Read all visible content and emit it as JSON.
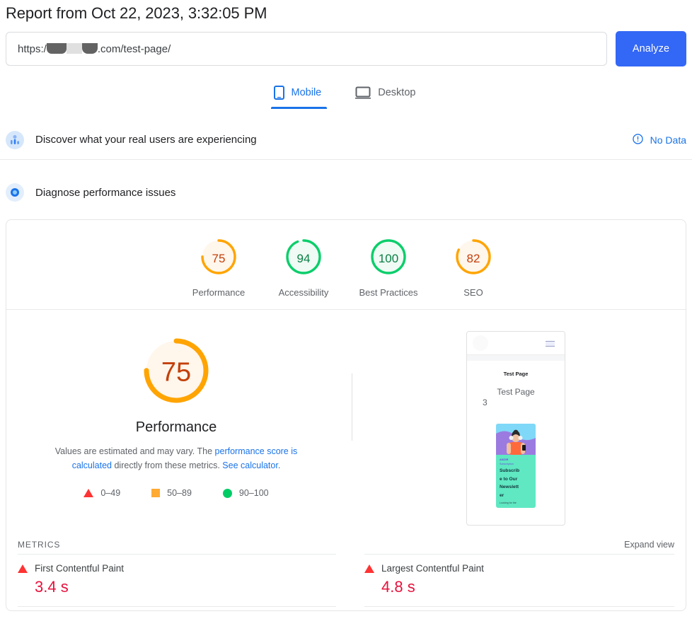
{
  "header": {
    "title": "Report from Oct 22, 2023, 3:32:05 PM",
    "url_prefix": "https:/",
    "url_suffix": ".com/test-page/",
    "url_full_visible": "https://[redacted].com/test-page/",
    "analyze_label": "Analyze"
  },
  "tabs": [
    {
      "label": "Mobile",
      "icon": "mobile-icon",
      "active": true
    },
    {
      "label": "Desktop",
      "icon": "desktop-icon",
      "active": false
    }
  ],
  "field_data": {
    "label": "Discover what your real users are experiencing",
    "icon": "crux-users-icon",
    "status": "No Data",
    "status_icon": "info-circle-icon"
  },
  "lab_data": {
    "label": "Diagnose performance issues",
    "icon": "lighthouse-icon"
  },
  "category_scores": [
    {
      "label": "Performance",
      "value": "75",
      "color": "#ffa400",
      "text_color": "#c3400a",
      "fill": "#fff6ec",
      "pct": 75
    },
    {
      "label": "Accessibility",
      "value": "94",
      "color": "#0cce6b",
      "text_color": "#0b7f45",
      "fill": "#effbf4",
      "pct": 94
    },
    {
      "label": "Best Practices",
      "value": "100",
      "color": "#0cce6b",
      "text_color": "#0b7f45",
      "fill": "#effbf4",
      "pct": 100
    },
    {
      "label": "SEO",
      "value": "82",
      "color": "#ffa400",
      "text_color": "#c3400a",
      "fill": "#fff6ec",
      "pct": 82
    }
  ],
  "performance": {
    "score": "75",
    "title": "Performance",
    "ring_color": "#ffa400",
    "fill_color": "#fff6ec",
    "score_color": "#c3400a",
    "disclaimer_pre": "Values are estimated and may vary. The ",
    "disclaimer_link1": "performance score is calculated",
    "disclaimer_mid": " directly from these metrics. ",
    "disclaimer_link2": "See calculator.",
    "legend": [
      {
        "shape": "triangle",
        "color": "#ff3333",
        "range": "0–49"
      },
      {
        "shape": "square",
        "color": "#ffaa33",
        "range": "50–89"
      },
      {
        "shape": "circle",
        "color": "#00cc66",
        "range": "90–100"
      }
    ]
  },
  "thumbnail": {
    "brand": "Test Page",
    "heading_line1": "Test Page",
    "heading_line2": "3",
    "card_eyebrow": "AMZ0R",
    "card_eyebrow2": "Subscription",
    "card_cta_line1": "Subscrib",
    "card_cta_line2": "e to Our",
    "card_cta_line3": "Newslett",
    "card_cta_line4": "er",
    "card_sub": "Looking for the",
    "menu_icon": "hamburger-icon"
  },
  "metrics": {
    "section_title": "METRICS",
    "expand_label": "Expand view",
    "items": [
      {
        "name": "First Contentful Paint",
        "value": "3.4 s",
        "status": "fail",
        "icon": "triangle-fail-icon"
      },
      {
        "name": "Largest Contentful Paint",
        "value": "4.8 s",
        "status": "fail",
        "icon": "triangle-fail-icon"
      }
    ]
  }
}
